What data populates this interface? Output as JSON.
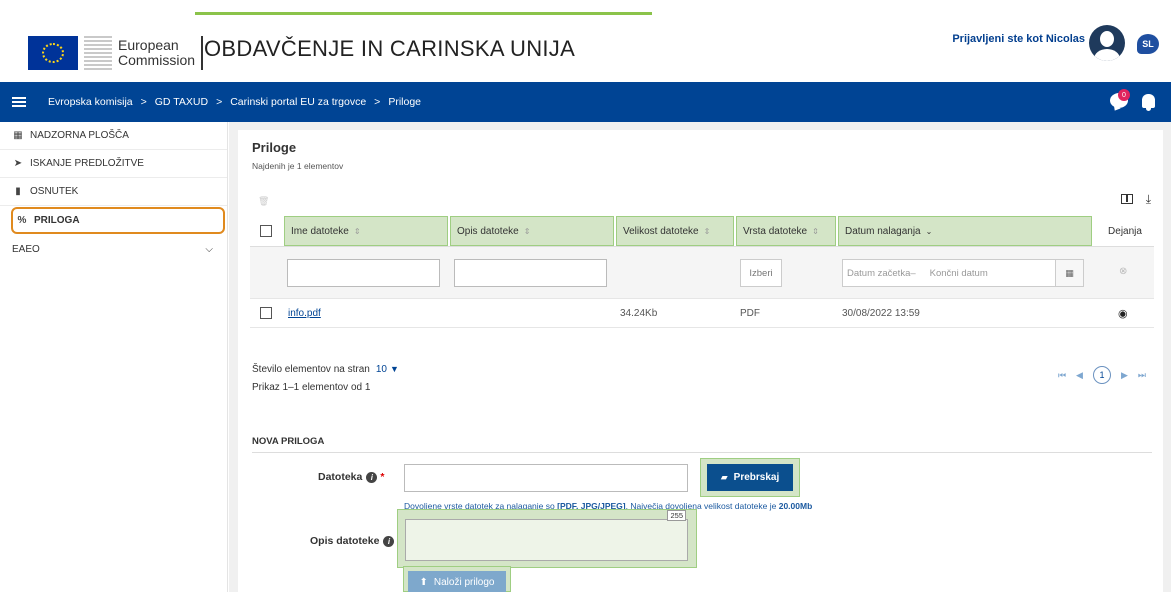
{
  "header": {
    "org_line1": "European",
    "org_line2": "Commission",
    "app_title": "OBDAVČENJE IN CARINSKA UNIJA",
    "user_text": "Prijavljeni ste kot Nicolas",
    "language": "SL",
    "notification_count": "0"
  },
  "breadcrumb": [
    "Evropska komisija",
    "GD TAXUD",
    "Carinski portal EU za trgovce",
    "Priloge"
  ],
  "sidebar": {
    "items": [
      {
        "label": "NADZORNA PLOŠČA",
        "icon": "dashboard-icon"
      },
      {
        "label": "ISKANJE PREDLOŽITVE",
        "icon": "send-icon"
      },
      {
        "label": "OSNUTEK",
        "icon": "file-icon"
      },
      {
        "label": "PRILOGA",
        "icon": "paperclip-icon"
      }
    ],
    "group_label": "EAEO"
  },
  "page": {
    "title": "Priloge",
    "subtitle": "Najdenih je 1 elementov"
  },
  "table": {
    "headers": [
      "Ime datoteke",
      "Opis datoteke",
      "Velikost datoteke",
      "Vrsta datoteke",
      "Datum nalaganja",
      "Dejanja"
    ],
    "sort_neutral": "⇕",
    "sort_desc": "⌄",
    "filters": {
      "select_label": "Izberi",
      "date_start_placeholder": "Datum začetka–",
      "date_end_placeholder": "Končni datum"
    },
    "rows": [
      {
        "name": "info.pdf",
        "size": "34.24Kb",
        "type": "PDF",
        "date": "30/08/2022 13:59"
      }
    ]
  },
  "pagination": {
    "per_page_label": "Število elementov na stran",
    "per_page_value": "10",
    "range_text": "Prikaz 1–1 elementov od 1",
    "current_page": "1"
  },
  "upload": {
    "section_title": "NOVA PRILOGA",
    "file_label": "Datoteka",
    "required_mark": "*",
    "browse_label": "Prebrskaj",
    "hint_prefix": "Dovoljene vrste datotek za nalaganje so",
    "hint_types": "[PDF, JPG/JPEG]",
    "hint_mid": ". Največja dovoljena velikost datoteke je",
    "hint_size": "20.00Mb",
    "desc_label": "Opis datoteke",
    "char_counter": "255",
    "submit_label": "Naloži prilogo"
  },
  "colors": {
    "navbar": "#004494",
    "highlight_fill": "#d4e5c7",
    "highlight_border": "#9fce82",
    "active_border": "#e08a1e",
    "top_accent": "#8bc34a"
  }
}
